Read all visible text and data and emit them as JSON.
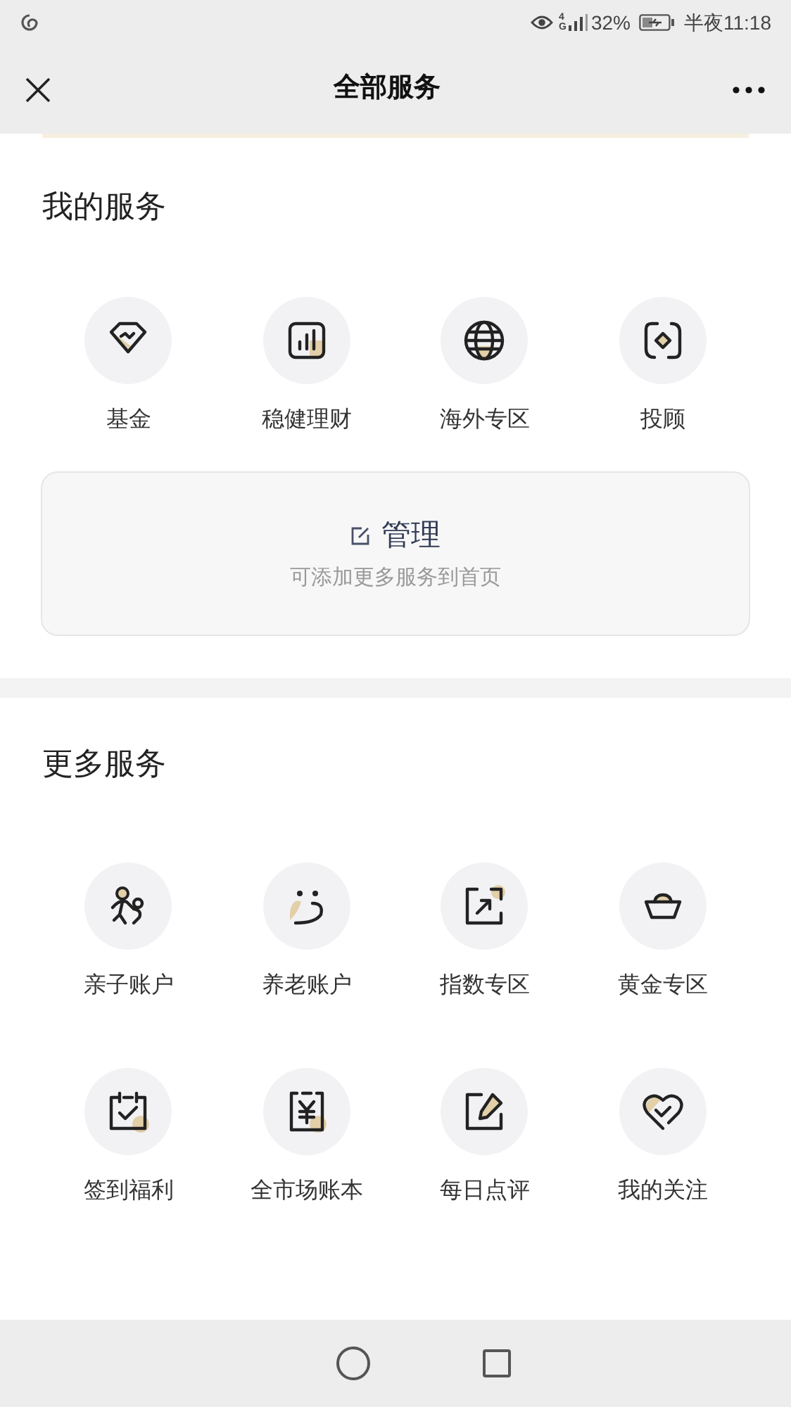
{
  "status_bar": {
    "network": "4G",
    "battery": "32%",
    "time": "半夜11:18"
  },
  "header": {
    "title": "全部服务"
  },
  "my_services": {
    "title": "我的服务",
    "items": [
      {
        "label": "基金"
      },
      {
        "label": "稳健理财"
      },
      {
        "label": "海外专区"
      },
      {
        "label": "投顾"
      }
    ],
    "manage": {
      "label": "管理",
      "hint": "可添加更多服务到首页"
    }
  },
  "more_services": {
    "title": "更多服务",
    "items": [
      {
        "label": "亲子账户"
      },
      {
        "label": "养老账户"
      },
      {
        "label": "指数专区"
      },
      {
        "label": "黄金专区"
      },
      {
        "label": "签到福利"
      },
      {
        "label": "全市场账本"
      },
      {
        "label": "每日点评"
      },
      {
        "label": "我的关注"
      }
    ]
  }
}
